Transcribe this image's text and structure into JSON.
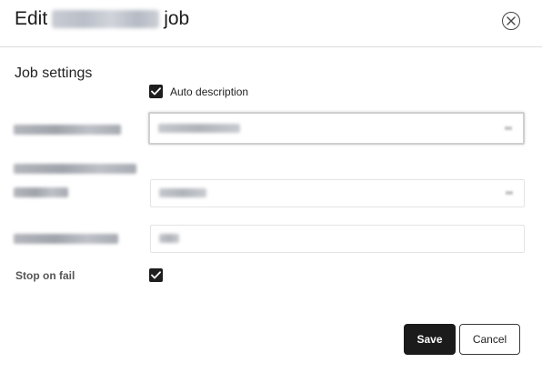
{
  "header": {
    "title_prefix": "Edit",
    "title_suffix": "job",
    "close_icon": "close-circle-icon"
  },
  "settings": {
    "section_title": "Job settings",
    "auto_description": {
      "label": "Auto description",
      "checked": true
    },
    "stop_on_fail": {
      "label": "Stop on fail",
      "checked": true
    }
  },
  "footer": {
    "save_label": "Save",
    "cancel_label": "Cancel"
  },
  "colors": {
    "primary_button": "#1b1b1b",
    "checkbox": "#1e1e1e",
    "divider": "#dcdcdc"
  }
}
